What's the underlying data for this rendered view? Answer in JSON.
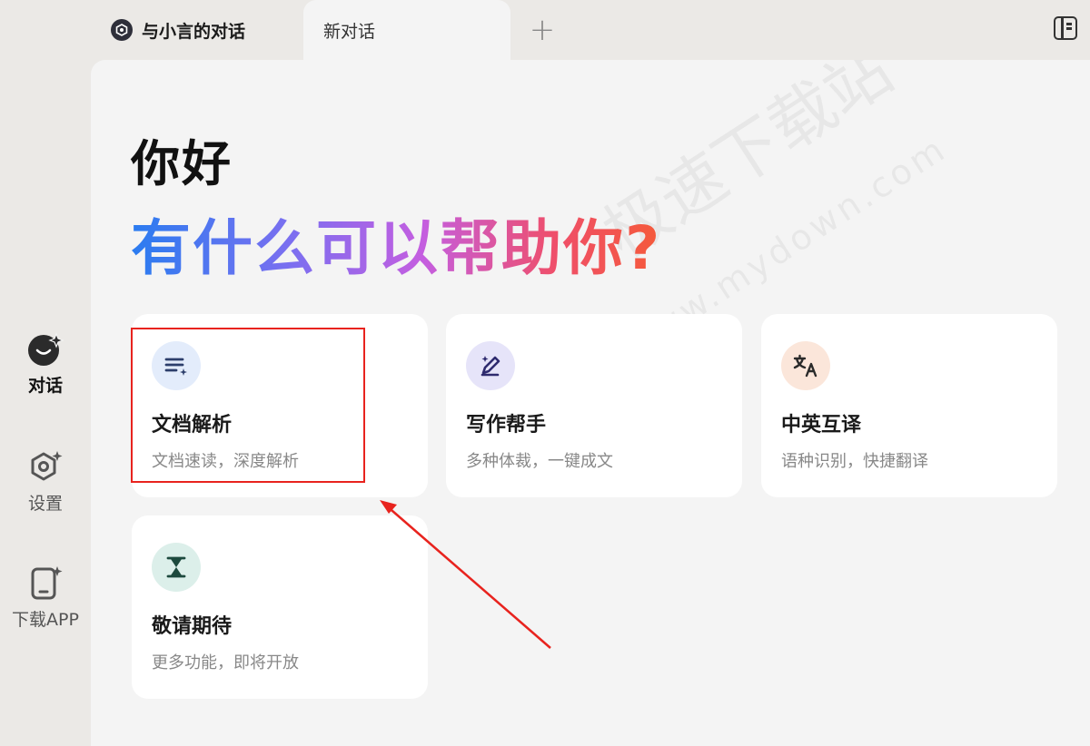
{
  "tabs": {
    "chat_tab": "与小言的对话",
    "new_tab": "新对话",
    "add": "+"
  },
  "sidebar": {
    "items": [
      {
        "label": "对话",
        "icon": "chat-bubble-sparkle-icon",
        "active": true
      },
      {
        "label": "设置",
        "icon": "settings-gear-icon",
        "active": false
      },
      {
        "label": "下载APP",
        "icon": "phone-download-icon",
        "active": false
      }
    ]
  },
  "main": {
    "greeting": "你好",
    "subtitle": "有什么可以帮助你?",
    "cards": [
      {
        "title": "文档解析",
        "desc": "文档速读，深度解析",
        "icon": "document-list-icon",
        "icon_bg": "#e3ecfb",
        "icon_color": "#2c3e6b"
      },
      {
        "title": "写作帮手",
        "desc": "多种体裁，一键成文",
        "icon": "pen-writing-icon",
        "icon_bg": "#e6e4f9",
        "icon_color": "#2e2a6e"
      },
      {
        "title": "中英互译",
        "desc": "语种识别，快捷翻译",
        "icon": "translate-icon",
        "icon_bg": "#fbe6da",
        "icon_color": "#2a2a2a"
      },
      {
        "title": "敬请期待",
        "desc": "更多功能，即将开放",
        "icon": "hourglass-icon",
        "icon_bg": "#dcefea",
        "icon_color": "#1d4a3e"
      }
    ]
  },
  "watermark": {
    "text": "极速下载站",
    "url": "www.mydown.com"
  },
  "colors": {
    "accent_red": "#e8231e",
    "gradient_start": "#2a7cf0",
    "gradient_end": "#f55a3a"
  }
}
